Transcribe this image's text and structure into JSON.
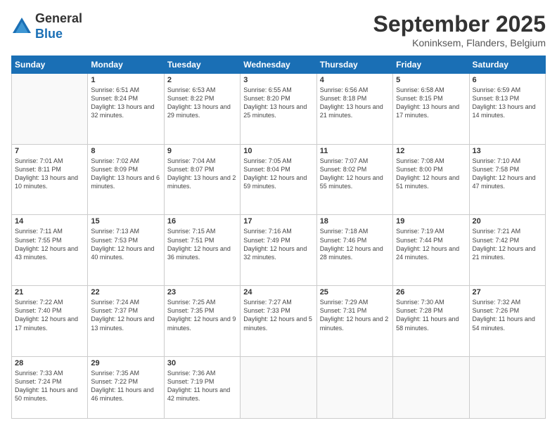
{
  "header": {
    "logo_general": "General",
    "logo_blue": "Blue",
    "title": "September 2025",
    "location": "Koninksem, Flanders, Belgium"
  },
  "days_of_week": [
    "Sunday",
    "Monday",
    "Tuesday",
    "Wednesday",
    "Thursday",
    "Friday",
    "Saturday"
  ],
  "weeks": [
    [
      {
        "day": "",
        "info": ""
      },
      {
        "day": "1",
        "info": "Sunrise: 6:51 AM\nSunset: 8:24 PM\nDaylight: 13 hours\nand 32 minutes."
      },
      {
        "day": "2",
        "info": "Sunrise: 6:53 AM\nSunset: 8:22 PM\nDaylight: 13 hours\nand 29 minutes."
      },
      {
        "day": "3",
        "info": "Sunrise: 6:55 AM\nSunset: 8:20 PM\nDaylight: 13 hours\nand 25 minutes."
      },
      {
        "day": "4",
        "info": "Sunrise: 6:56 AM\nSunset: 8:18 PM\nDaylight: 13 hours\nand 21 minutes."
      },
      {
        "day": "5",
        "info": "Sunrise: 6:58 AM\nSunset: 8:15 PM\nDaylight: 13 hours\nand 17 minutes."
      },
      {
        "day": "6",
        "info": "Sunrise: 6:59 AM\nSunset: 8:13 PM\nDaylight: 13 hours\nand 14 minutes."
      }
    ],
    [
      {
        "day": "7",
        "info": "Sunrise: 7:01 AM\nSunset: 8:11 PM\nDaylight: 13 hours\nand 10 minutes."
      },
      {
        "day": "8",
        "info": "Sunrise: 7:02 AM\nSunset: 8:09 PM\nDaylight: 13 hours\nand 6 minutes."
      },
      {
        "day": "9",
        "info": "Sunrise: 7:04 AM\nSunset: 8:07 PM\nDaylight: 13 hours\nand 2 minutes."
      },
      {
        "day": "10",
        "info": "Sunrise: 7:05 AM\nSunset: 8:04 PM\nDaylight: 12 hours\nand 59 minutes."
      },
      {
        "day": "11",
        "info": "Sunrise: 7:07 AM\nSunset: 8:02 PM\nDaylight: 12 hours\nand 55 minutes."
      },
      {
        "day": "12",
        "info": "Sunrise: 7:08 AM\nSunset: 8:00 PM\nDaylight: 12 hours\nand 51 minutes."
      },
      {
        "day": "13",
        "info": "Sunrise: 7:10 AM\nSunset: 7:58 PM\nDaylight: 12 hours\nand 47 minutes."
      }
    ],
    [
      {
        "day": "14",
        "info": "Sunrise: 7:11 AM\nSunset: 7:55 PM\nDaylight: 12 hours\nand 43 minutes."
      },
      {
        "day": "15",
        "info": "Sunrise: 7:13 AM\nSunset: 7:53 PM\nDaylight: 12 hours\nand 40 minutes."
      },
      {
        "day": "16",
        "info": "Sunrise: 7:15 AM\nSunset: 7:51 PM\nDaylight: 12 hours\nand 36 minutes."
      },
      {
        "day": "17",
        "info": "Sunrise: 7:16 AM\nSunset: 7:49 PM\nDaylight: 12 hours\nand 32 minutes."
      },
      {
        "day": "18",
        "info": "Sunrise: 7:18 AM\nSunset: 7:46 PM\nDaylight: 12 hours\nand 28 minutes."
      },
      {
        "day": "19",
        "info": "Sunrise: 7:19 AM\nSunset: 7:44 PM\nDaylight: 12 hours\nand 24 minutes."
      },
      {
        "day": "20",
        "info": "Sunrise: 7:21 AM\nSunset: 7:42 PM\nDaylight: 12 hours\nand 21 minutes."
      }
    ],
    [
      {
        "day": "21",
        "info": "Sunrise: 7:22 AM\nSunset: 7:40 PM\nDaylight: 12 hours\nand 17 minutes."
      },
      {
        "day": "22",
        "info": "Sunrise: 7:24 AM\nSunset: 7:37 PM\nDaylight: 12 hours\nand 13 minutes."
      },
      {
        "day": "23",
        "info": "Sunrise: 7:25 AM\nSunset: 7:35 PM\nDaylight: 12 hours\nand 9 minutes."
      },
      {
        "day": "24",
        "info": "Sunrise: 7:27 AM\nSunset: 7:33 PM\nDaylight: 12 hours\nand 5 minutes."
      },
      {
        "day": "25",
        "info": "Sunrise: 7:29 AM\nSunset: 7:31 PM\nDaylight: 12 hours\nand 2 minutes."
      },
      {
        "day": "26",
        "info": "Sunrise: 7:30 AM\nSunset: 7:28 PM\nDaylight: 11 hours\nand 58 minutes."
      },
      {
        "day": "27",
        "info": "Sunrise: 7:32 AM\nSunset: 7:26 PM\nDaylight: 11 hours\nand 54 minutes."
      }
    ],
    [
      {
        "day": "28",
        "info": "Sunrise: 7:33 AM\nSunset: 7:24 PM\nDaylight: 11 hours\nand 50 minutes."
      },
      {
        "day": "29",
        "info": "Sunrise: 7:35 AM\nSunset: 7:22 PM\nDaylight: 11 hours\nand 46 minutes."
      },
      {
        "day": "30",
        "info": "Sunrise: 7:36 AM\nSunset: 7:19 PM\nDaylight: 11 hours\nand 42 minutes."
      },
      {
        "day": "",
        "info": ""
      },
      {
        "day": "",
        "info": ""
      },
      {
        "day": "",
        "info": ""
      },
      {
        "day": "",
        "info": ""
      }
    ]
  ]
}
